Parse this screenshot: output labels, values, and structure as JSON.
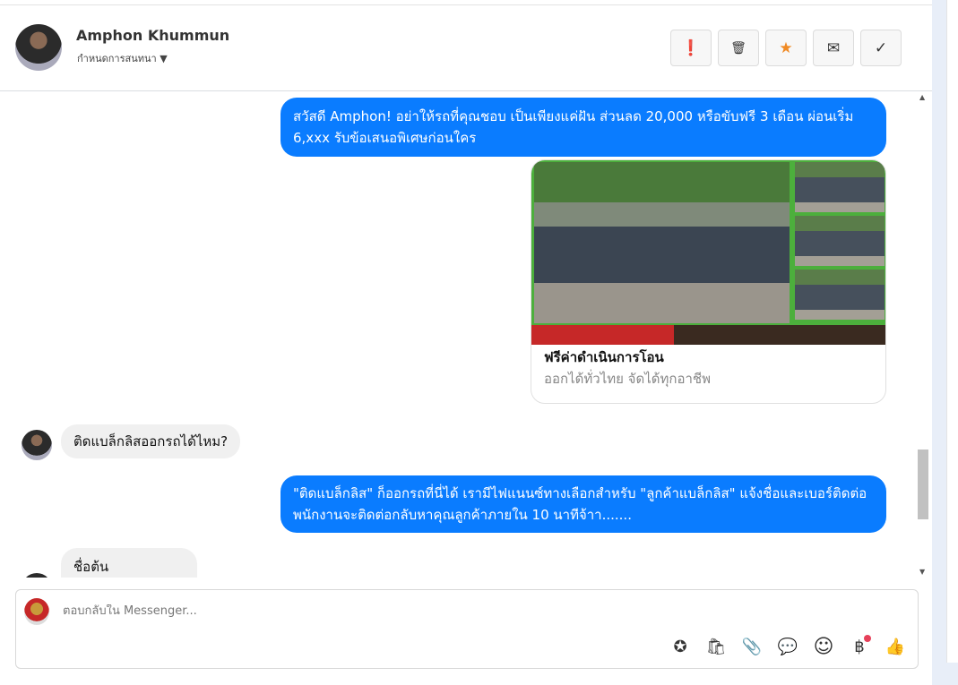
{
  "header": {
    "name": "Amphon Khummun",
    "subtitle": "กำหนดการสนทนา",
    "actions": [
      {
        "name": "report",
        "glyph": "❗"
      },
      {
        "name": "delete",
        "glyph": "🗑"
      },
      {
        "name": "star",
        "glyph": "★"
      },
      {
        "name": "mail",
        "glyph": "✉"
      },
      {
        "name": "done",
        "glyph": "✓"
      }
    ]
  },
  "messages": [
    {
      "dir": "out",
      "text": "สวัสดี Amphon! อย่าให้รถที่คุณชอบ เป็นเพียงแค่ฝัน ส่วนลด 20,000 หรือขับฟรี 3 เดือน ผ่อนเริ่ม 6,xxx รับข้อเสนอพิเศษก่อนใคร"
    },
    {
      "dir": "out",
      "card": {
        "title": "ฟรีค่าดำเนินการโอน",
        "subtitle": "ออกได้ทั่วไทย จัดได้ทุกอาชีพ"
      }
    },
    {
      "dir": "in",
      "text": "ติดแบล็กลิสออกรถได้ไหม?"
    },
    {
      "dir": "out",
      "text": "\"ติดแบล็กลิส\" ก็ออกรถที่นี่ได้ เรามีไฟแนนซ์ทางเลือกสำหรับ \"ลูกค้าแบล็กลิส\" แจ้งชื่อและเบอร์ติดต่อ พนักงานจะติดต่อกลับหาคุณลูกค้าภายใน 10 นาทีจ้าา......."
    },
    {
      "dir": "in",
      "text": "ชื่อต้น"
    }
  ],
  "composer": {
    "placeholder": "ตอบกลับใน Messenger...",
    "icons": [
      {
        "name": "saved-reply",
        "glyph": "✪"
      },
      {
        "name": "shop",
        "glyph": "🛍"
      },
      {
        "name": "attach",
        "glyph": "📎"
      },
      {
        "name": "chat",
        "glyph": "💬"
      },
      {
        "name": "emoji",
        "glyph": "☺"
      },
      {
        "name": "payment",
        "glyph": "฿"
      },
      {
        "name": "like",
        "glyph": "👍"
      }
    ]
  },
  "colors": {
    "outgoing": "#0a7cff",
    "incoming": "#f0f0f0",
    "star": "#f08a24"
  }
}
